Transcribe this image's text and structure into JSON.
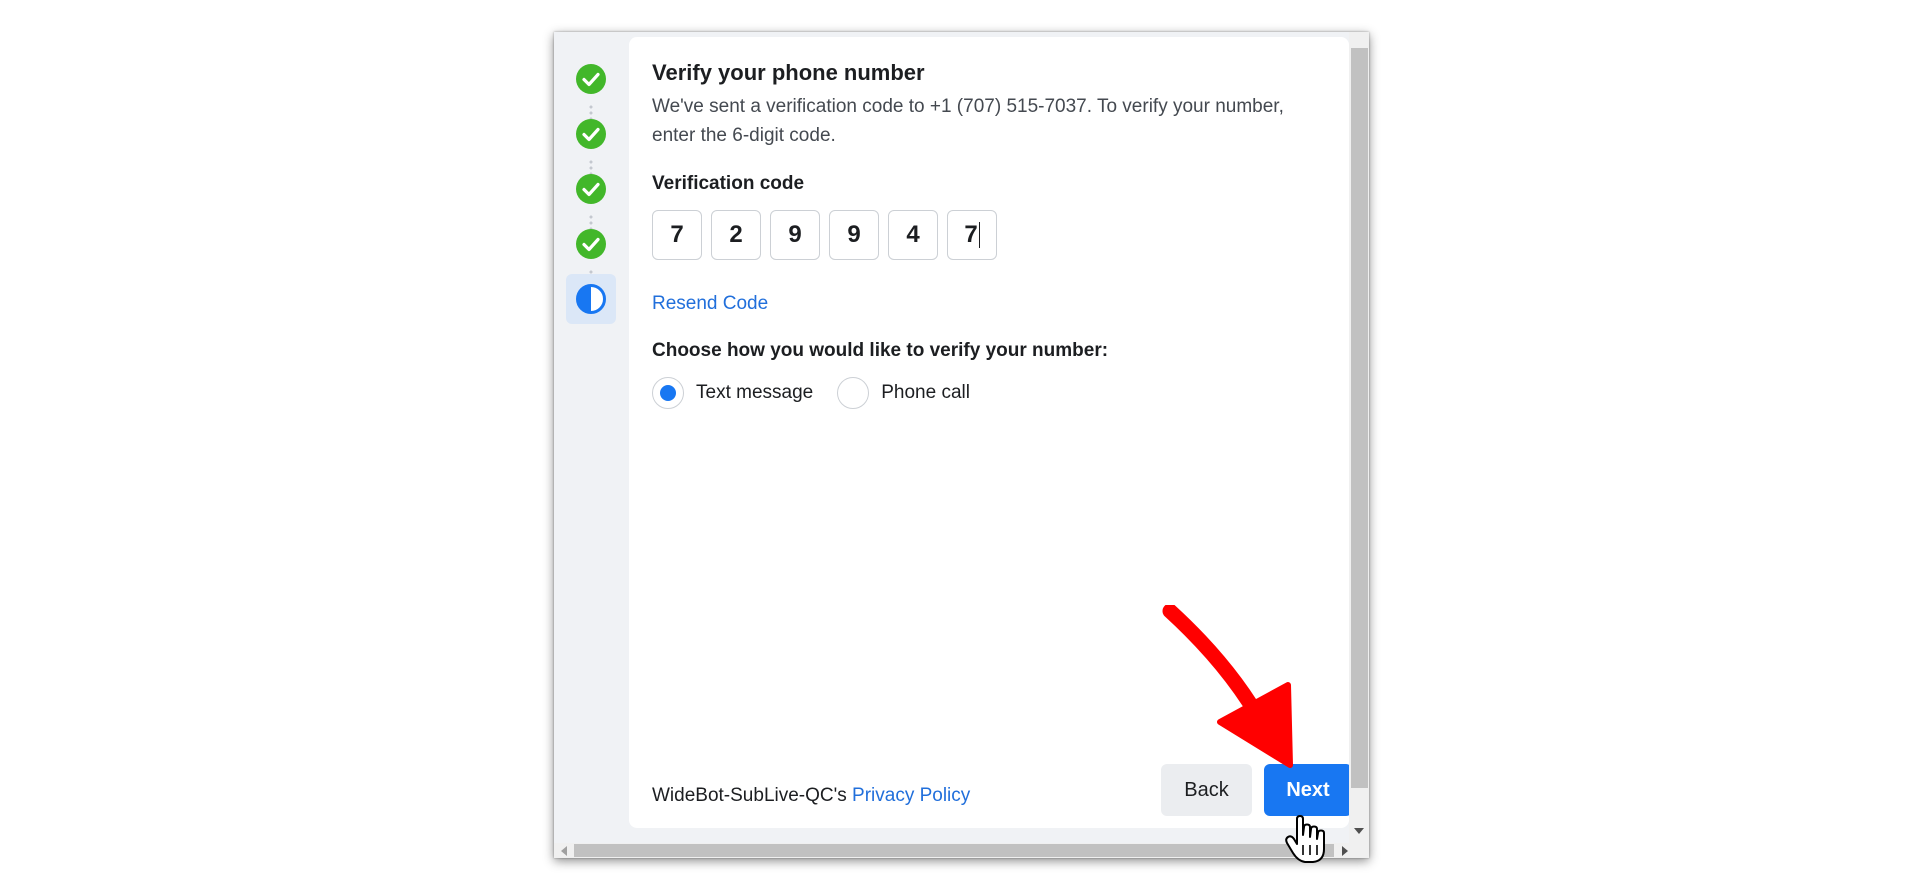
{
  "stepper": {
    "steps": [
      {
        "status": "complete",
        "icon": "check-circle-icon"
      },
      {
        "status": "complete",
        "icon": "check-circle-icon"
      },
      {
        "status": "complete",
        "icon": "check-circle-icon"
      },
      {
        "status": "complete",
        "icon": "check-circle-icon"
      },
      {
        "status": "current",
        "icon": "half-circle-icon"
      }
    ],
    "complete_color": "#42b72a",
    "current_color": "#1877f2"
  },
  "verify": {
    "title": "Verify your phone number",
    "description": "We've sent a verification code to +1 (707) 515-7037. To verify your number, enter the 6-digit code.",
    "code_label": "Verification code",
    "code_digits": [
      "7",
      "2",
      "9",
      "9",
      "4",
      "7"
    ],
    "resend_label": "Resend Code",
    "method_prompt": "Choose how you would like to verify your number:",
    "methods": [
      {
        "label": "Text message",
        "selected": true
      },
      {
        "label": "Phone call",
        "selected": false
      }
    ]
  },
  "footer": {
    "app_name_prefix": "WideBot-SubLive-QC's",
    "privacy_link": "Privacy Policy",
    "back_label": "Back",
    "next_label": "Next"
  },
  "colors": {
    "primary": "#1877f2",
    "link": "#216fdb",
    "annotation_arrow": "#ff0000"
  }
}
